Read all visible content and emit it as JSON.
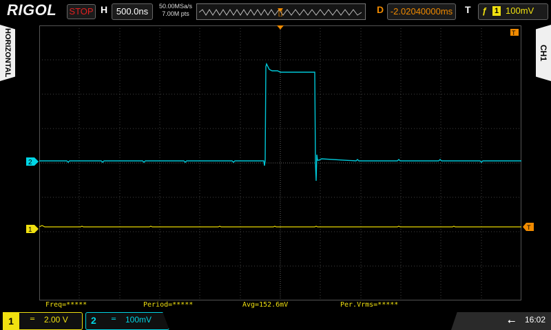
{
  "header": {
    "brand": "RIGOL",
    "run_status": "STOP",
    "h_label": "H",
    "timebase": "500.0ns",
    "sample_rate": "50.00MSa/s",
    "memory_depth": "7.00M pts",
    "d_label": "D",
    "delay": "-2.02040000ms",
    "t_label": "T",
    "trigger_edge_icon": "rising-edge-icon",
    "trigger_source": "1",
    "trigger_level": "100mV"
  },
  "side_tabs": {
    "left": "HORIZONTAL",
    "right": "CH1"
  },
  "markers": {
    "ch2": "2",
    "ch1": "1",
    "trigger": "T"
  },
  "measurements": [
    {
      "label": "Freq=*****"
    },
    {
      "label": "Period=*****"
    },
    {
      "label": "Avg=152.6mV"
    },
    {
      "label": "Per.Vrms=*****"
    }
  ],
  "channels": {
    "ch1": {
      "number": "1",
      "coupling": "═",
      "scale": "2.00 V",
      "color": "#f0e010"
    },
    "ch2": {
      "number": "2",
      "coupling": "═",
      "scale": "100mV",
      "color": "#00d6e6"
    }
  },
  "status": {
    "usb_icon": "usb-icon",
    "time": "16:02"
  },
  "colors": {
    "grid": "#505050",
    "run_stop": "#e02020",
    "delay": "#f08a00"
  }
}
